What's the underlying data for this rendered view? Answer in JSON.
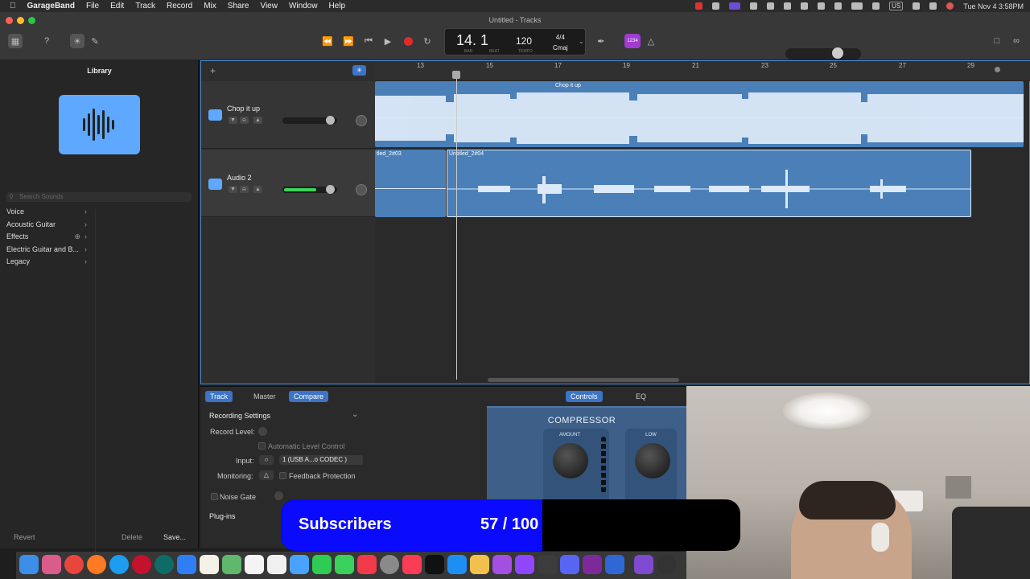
{
  "menubar": {
    "app": "GarageBand",
    "items": [
      "File",
      "Edit",
      "Track",
      "Record",
      "Mix",
      "Share",
      "View",
      "Window",
      "Help"
    ],
    "input_source": "US",
    "clock": "Tue Nov 4  3:58PM"
  },
  "window": {
    "title": "Untitled - Tracks"
  },
  "lcd": {
    "position": "14. 1",
    "bar_label": "BAR",
    "beat_label": "BEAT",
    "tempo": "120",
    "tempo_label": "TEMPO",
    "time_signature": "4/4",
    "key": "Cmaj"
  },
  "toolbar": {
    "count_in": "1234"
  },
  "library": {
    "title": "Library",
    "search_placeholder": "Search Sounds",
    "items": [
      {
        "label": "Voice"
      },
      {
        "label": "Acoustic Guitar"
      },
      {
        "label": "Effects"
      },
      {
        "label": "Electric Guitar and B..."
      },
      {
        "label": "Legacy"
      }
    ],
    "revert": "Revert",
    "delete": "Delete",
    "save": "Save..."
  },
  "ruler": {
    "bars": [
      "13",
      "15",
      "17",
      "19",
      "21",
      "23",
      "25",
      "27",
      "29"
    ]
  },
  "tracks": [
    {
      "name": "Chop it up",
      "volume": 0.82
    },
    {
      "name": "Audio 2",
      "volume": 0.82,
      "meter": 0.62
    }
  ],
  "regions": {
    "track1": "Chop it up",
    "track2_a": "tled_2#03",
    "track2_b": "Untitled_2#04"
  },
  "smart_controls": {
    "tabs": [
      "Track",
      "Master",
      "Compare"
    ],
    "right_tabs": [
      "Controls",
      "EQ"
    ],
    "section": "Recording Settings",
    "record_level": "Record Level:",
    "auto_level": "Automatic Level Control",
    "input_label": "Input:",
    "input_value": "1 (USB A...o CODEC )",
    "monitoring_label": "Monitoring:",
    "feedback": "Feedback Protection",
    "noise_gate": "Noise Gate",
    "plugins": "Plug-ins",
    "compressor": {
      "title": "COMPRESSOR",
      "amount": "AMOUNT",
      "low": "LOW"
    }
  },
  "overlay": {
    "label": "Subscribers",
    "count": "57 / 100",
    "progress": 0.57
  },
  "colors": {
    "accent": "#4a90d9",
    "region": "#4a7fb8",
    "region_wave": "#dbe9f8",
    "overlay_bar": "#0a0aff",
    "meter": "#3ed35a"
  }
}
